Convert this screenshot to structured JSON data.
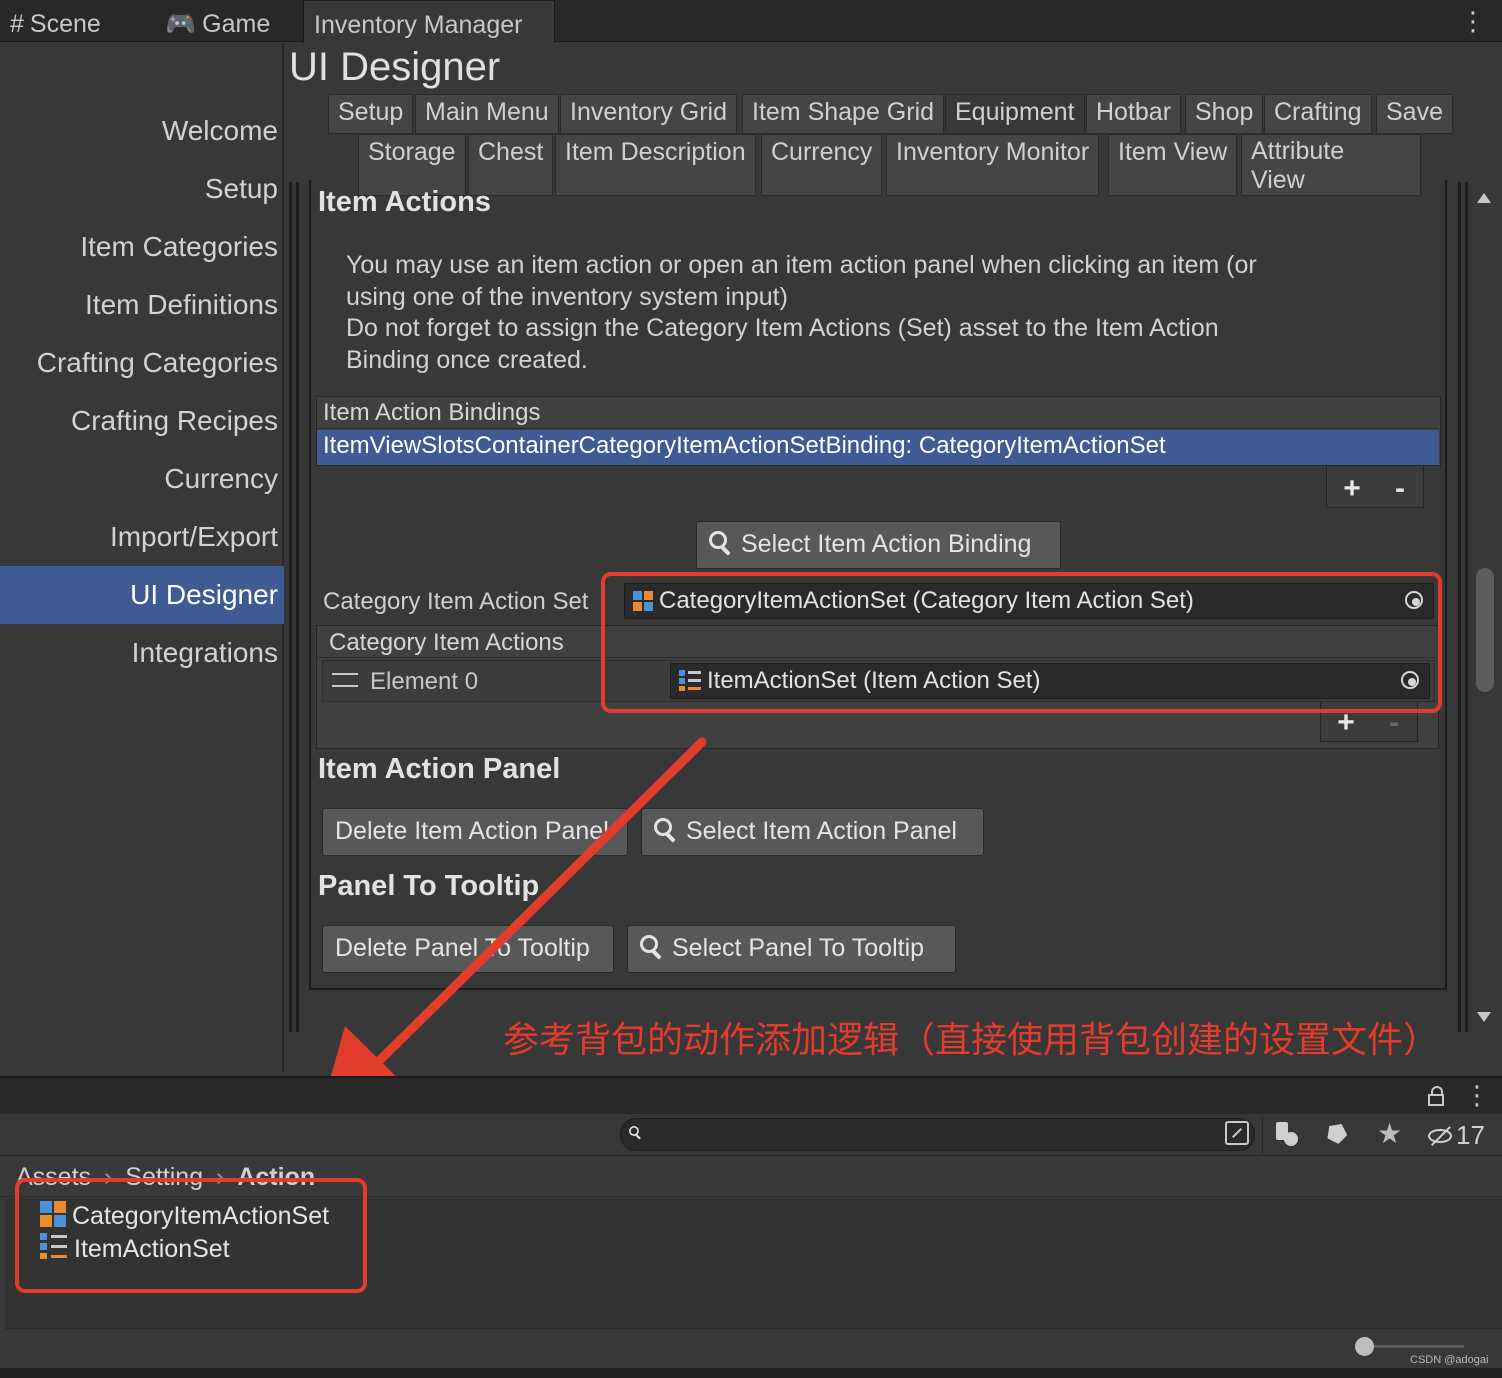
{
  "window_tabs": [
    {
      "label": "Scene",
      "icon": "grid-hash-icon"
    },
    {
      "label": "Game",
      "icon": "gamepad-icon"
    },
    {
      "label": "Inventory Manager"
    }
  ],
  "nav": {
    "items": [
      "Welcome",
      "Setup",
      "Item Categories",
      "Item Definitions",
      "Crafting Categories",
      "Crafting Recipes",
      "Currency",
      "Import/Export",
      "UI Designer",
      "Integrations"
    ],
    "active": "UI Designer"
  },
  "main": {
    "title": "UI Designer",
    "subtabs_row1": [
      "Setup",
      "Main Menu",
      "Inventory Grid",
      "Item Shape Grid",
      "Equipment",
      "Hotbar",
      "Shop",
      "Crafting",
      "Save"
    ],
    "subtabs_row2": [
      "Storage",
      "Chest",
      "Item Description",
      "Currency",
      "Inventory Monitor",
      "Item View",
      "Attribute",
      "View"
    ],
    "selected_subtab": "Equipment"
  },
  "item_actions": {
    "heading": "Item Actions",
    "desc_lines": [
      "You may use an item action or open an item action panel when clicking an item (or",
      "using one of the inventory system input)",
      "Do not forget to assign the Category Item Actions (Set) asset to the Item Action",
      "Binding once created."
    ],
    "bindings_header": "Item Action Bindings",
    "binding_row": "ItemViewSlotsContainerCategoryItemActionSetBinding: CategoryItemActionSet",
    "plus": "+",
    "minus": "-",
    "select_binding_button": "Select Item Action Binding",
    "category_set_label": "Category Item Action Set",
    "category_set_value": "CategoryItemActionSet (Category Item Action Set)",
    "category_actions_header": "Category Item Actions",
    "element0_label": "Element 0",
    "element0_value": "ItemActionSet (Item Action Set)"
  },
  "item_action_panel": {
    "heading": "Item Action Panel",
    "delete_button": "Delete Item Action Panel",
    "select_button": "Select Item Action Panel"
  },
  "panel_to_tooltip": {
    "heading": "Panel To Tooltip",
    "delete_button": "Delete Panel To Tooltip",
    "select_button": "Select Panel To Tooltip"
  },
  "annotation": "参考背包的动作添加逻辑（直接使用背包创建的设置文件）",
  "project": {
    "hidden_count": "17",
    "breadcrumb": [
      "Assets",
      "Setting",
      "Action"
    ],
    "files": [
      {
        "name": "CategoryItemActionSet",
        "icon": "category-set-icon"
      },
      {
        "name": "ItemActionSet",
        "icon": "item-action-set-icon"
      }
    ]
  },
  "watermark": "CSDN @adogai",
  "colors": {
    "accent_selection": "#3e5b93",
    "annotation_red": "#e23c2c",
    "panel_bg": "#383838"
  }
}
